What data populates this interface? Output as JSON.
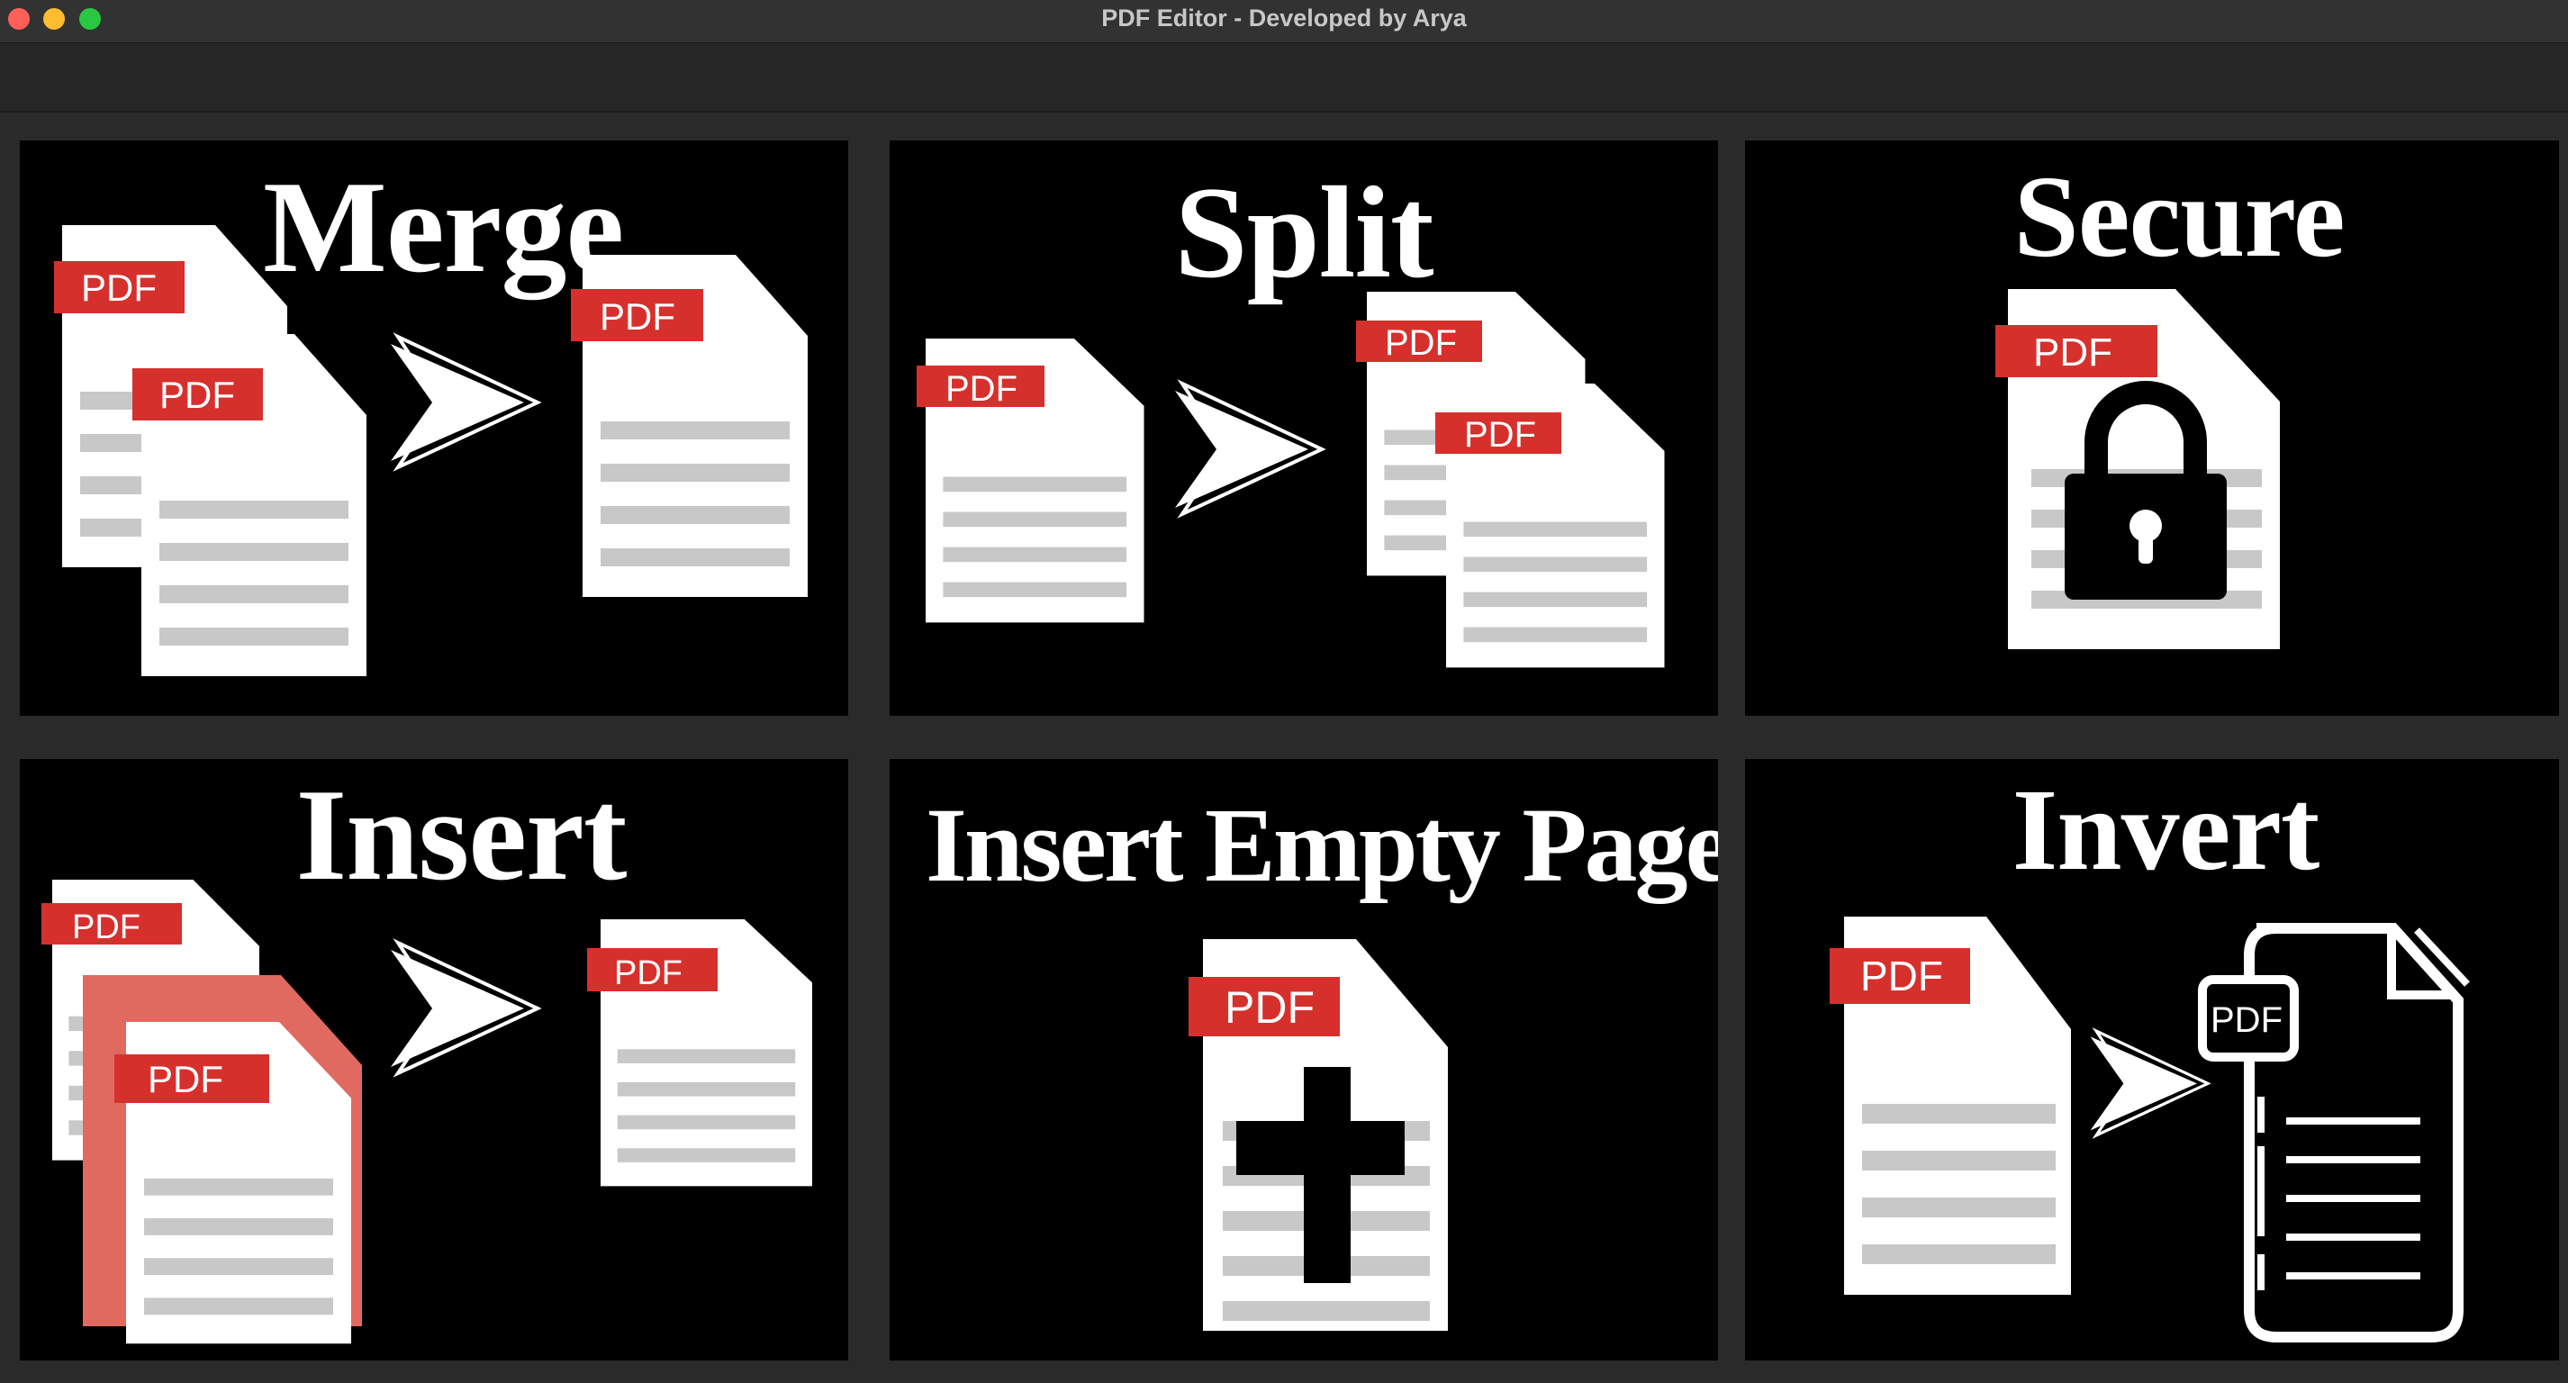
{
  "window": {
    "title": "PDF Editor - Developed by Arya"
  },
  "colors": {
    "close": "#ff5f57",
    "minimize": "#febc2e",
    "zoom": "#28c840",
    "pdf_tag": "#d6302d",
    "insert_page": "#e06a60"
  },
  "tiles": [
    {
      "title": "Merge",
      "icon": "merge-icon"
    },
    {
      "title": "Split",
      "icon": "split-icon"
    },
    {
      "title": "Secure",
      "icon": "lock-icon"
    },
    {
      "title": "Insert",
      "icon": "insert-icon"
    },
    {
      "title": "Insert Empty Page",
      "icon": "plus-icon"
    },
    {
      "title": "Invert",
      "icon": "invert-icon"
    }
  ],
  "pdf_label": "PDF"
}
